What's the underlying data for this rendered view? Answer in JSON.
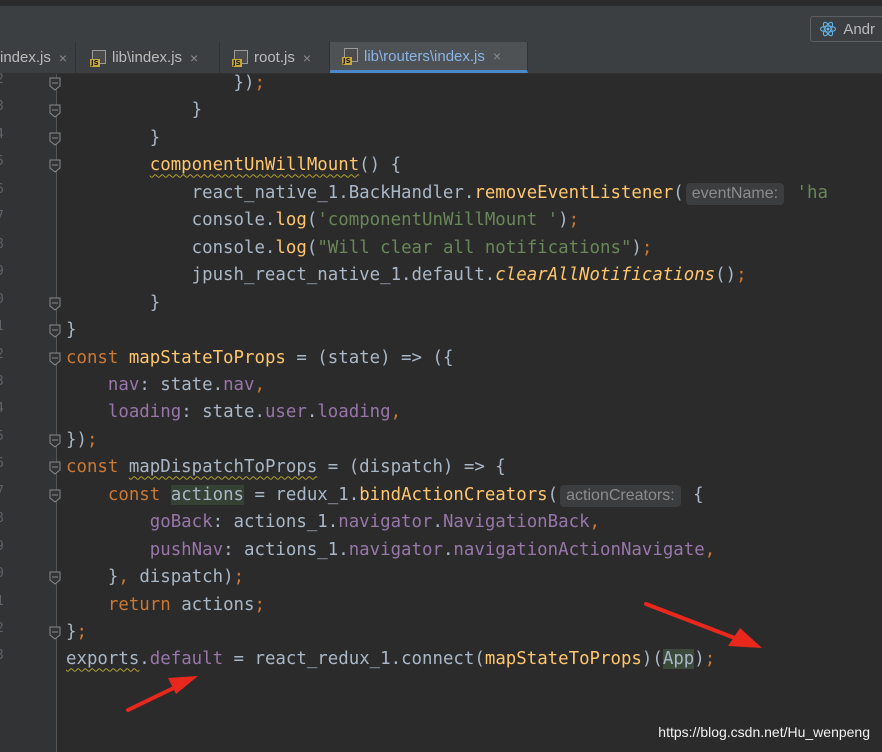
{
  "toolbar": {
    "run_config_label": "Andr",
    "run_config_icon": "react-icon"
  },
  "tabs": [
    {
      "label": "index.js",
      "active": false
    },
    {
      "label": "lib\\index.js",
      "active": false
    },
    {
      "label": "root.js",
      "active": false
    },
    {
      "label": "lib\\routers\\index.js",
      "active": true
    }
  ],
  "tab_close_glyph": "×",
  "code_lines": [
    {
      "id": "l0",
      "indent": "                ",
      "tokens": [
        [
          "p",
          "})"
        ],
        [
          "kw",
          ";"
        ]
      ]
    },
    {
      "id": "l1",
      "indent": "            ",
      "tokens": [
        [
          "p",
          "}"
        ]
      ]
    },
    {
      "id": "l2",
      "indent": "        ",
      "tokens": [
        [
          "p",
          "}"
        ]
      ]
    },
    {
      "id": "l3",
      "indent": "        ",
      "tokens": [
        [
          "fn-sq",
          "componentUnWillMount"
        ],
        [
          "p",
          "() {"
        ]
      ]
    },
    {
      "id": "l4",
      "indent": "            ",
      "tokens": [
        [
          "p",
          "react_native_1.BackHandler."
        ],
        [
          "fn",
          "removeEventListener"
        ],
        [
          "p",
          "("
        ],
        [
          "hint",
          "eventName:"
        ],
        [
          "str",
          " 'ha"
        ]
      ]
    },
    {
      "id": "l5",
      "indent": "            ",
      "tokens": [
        [
          "p",
          "console."
        ],
        [
          "fn",
          "log"
        ],
        [
          "p",
          "("
        ],
        [
          "str",
          "'componentUnWillMount '"
        ],
        [
          "p",
          ")"
        ],
        [
          "kw",
          ";"
        ]
      ]
    },
    {
      "id": "l6",
      "indent": "            ",
      "tokens": [
        [
          "p",
          "console."
        ],
        [
          "fn",
          "log"
        ],
        [
          "p",
          "("
        ],
        [
          "str",
          "\"Will clear all notifications\""
        ],
        [
          "p",
          ")"
        ],
        [
          "kw",
          ";"
        ]
      ]
    },
    {
      "id": "l7",
      "indent": "            ",
      "tokens": [
        [
          "p",
          "jpush_react_native_1.default."
        ],
        [
          "fni",
          "clearAllNotifications"
        ],
        [
          "p",
          "()"
        ],
        [
          "kw",
          ";"
        ]
      ]
    },
    {
      "id": "l8",
      "indent": "        ",
      "tokens": [
        [
          "p",
          "}"
        ]
      ]
    },
    {
      "id": "l9",
      "indent": "",
      "tokens": [
        [
          "p",
          "}"
        ]
      ]
    },
    {
      "id": "l10",
      "indent": "",
      "tokens": [
        [
          "kw",
          "const "
        ],
        [
          "fn",
          "mapStateToProps"
        ],
        [
          "p",
          " = (state) => ({"
        ]
      ]
    },
    {
      "id": "l11",
      "indent": "    ",
      "tokens": [
        [
          "prop",
          "nav"
        ],
        [
          "p",
          ": state."
        ],
        [
          "prop",
          "nav"
        ],
        [
          "kw",
          ","
        ]
      ]
    },
    {
      "id": "l12",
      "indent": "    ",
      "tokens": [
        [
          "prop",
          "loading"
        ],
        [
          "p",
          ": state."
        ],
        [
          "prop",
          "user"
        ],
        [
          "p",
          "."
        ],
        [
          "prop",
          "loading"
        ],
        [
          "kw",
          ","
        ]
      ]
    },
    {
      "id": "l13",
      "indent": "",
      "tokens": [
        [
          "p",
          "})"
        ],
        [
          "kw",
          ";"
        ]
      ]
    },
    {
      "id": "l14",
      "indent": "",
      "tokens": [
        [
          "kw",
          "const "
        ],
        [
          "p-sq",
          "mapDispatchToProps"
        ],
        [
          "p",
          " = (dispatch) => {"
        ]
      ]
    },
    {
      "id": "l15",
      "indent": "    ",
      "tokens": [
        [
          "kw",
          "const "
        ],
        [
          "p-hl",
          "actions"
        ],
        [
          "p",
          " = redux_1."
        ],
        [
          "fn",
          "bindActionCreators"
        ],
        [
          "p",
          "("
        ],
        [
          "hint",
          "actionCreators:"
        ],
        [
          "p",
          " {"
        ]
      ]
    },
    {
      "id": "l16",
      "indent": "        ",
      "tokens": [
        [
          "prop",
          "goBack"
        ],
        [
          "p",
          ": actions_1."
        ],
        [
          "prop",
          "navigator"
        ],
        [
          "p",
          "."
        ],
        [
          "prop",
          "NavigationBack"
        ],
        [
          "kw",
          ","
        ]
      ]
    },
    {
      "id": "l17",
      "indent": "        ",
      "tokens": [
        [
          "prop",
          "pushNav"
        ],
        [
          "p",
          ": actions_1."
        ],
        [
          "prop",
          "navigator"
        ],
        [
          "p",
          "."
        ],
        [
          "prop",
          "navigationActionNavigate"
        ],
        [
          "kw",
          ","
        ]
      ]
    },
    {
      "id": "l18",
      "indent": "    ",
      "tokens": [
        [
          "p",
          "}"
        ],
        [
          "kw",
          ","
        ],
        [
          "p",
          " dispatch)"
        ],
        [
          "kw",
          ";"
        ]
      ]
    },
    {
      "id": "l19",
      "indent": "    ",
      "tokens": [
        [
          "kw",
          "return "
        ],
        [
          "p",
          "actions"
        ],
        [
          "kw",
          ";"
        ]
      ]
    },
    {
      "id": "l20",
      "indent": "",
      "tokens": [
        [
          "p",
          "}"
        ],
        [
          "kw",
          ";"
        ]
      ]
    },
    {
      "id": "l21",
      "indent": "",
      "tokens": [
        [
          "p-sq",
          "exports"
        ],
        [
          "p",
          "."
        ],
        [
          "prop",
          "default"
        ],
        [
          "p",
          " = react_redux_1.connect("
        ],
        [
          "fn",
          "mapStateToProps"
        ],
        [
          "p",
          ")("
        ],
        [
          "app",
          "App"
        ],
        [
          "p",
          ")"
        ],
        [
          "kw",
          ";"
        ]
      ]
    }
  ],
  "watermark": "https://blog.csdn.net/Hu_wenpeng",
  "annotation_color": "#e8281c"
}
